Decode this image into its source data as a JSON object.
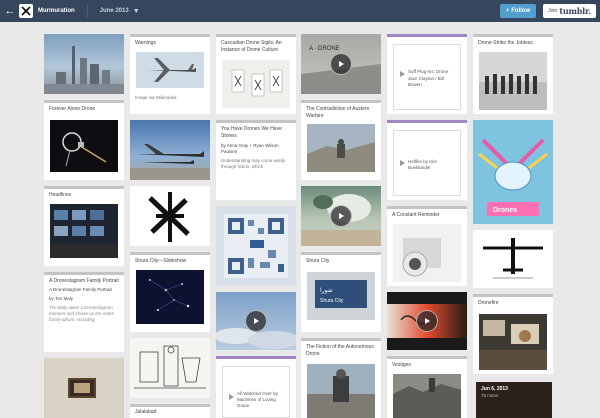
{
  "header": {
    "blog_name": "Murmuration",
    "archive_month": "June 2013",
    "follow_label": "Follow",
    "join_label": "Join",
    "brand": "tumblr."
  },
  "posts": {
    "warnings": {
      "title": "Warnings",
      "caption": "Image via Wikimedia"
    },
    "cascadian": {
      "title": "Cascadian Drone Sigils: An Instance of Drone Culture"
    },
    "suff": {
      "title": "Suff Plug-Ins: Drone",
      "author": "Jace Clayton / Bill Bowen"
    },
    "strike": {
      "title": "Drone-Strike the Jobless"
    },
    "forever": {
      "title": "Forever Alone Drone"
    },
    "contradiction": {
      "title": "The Contradiction of Austere Warfare"
    },
    "stones": {
      "title": "You Have Drones We Have Stones",
      "author": "by Anna Gray + Ryan Wilson Paulsen",
      "excerpt": "Understanding may come easily through fiction, which"
    },
    "hellfire": {
      "title": "Hellfire by Kim Boekbinder"
    },
    "headlines": {
      "title": "Headlines"
    },
    "reminder": {
      "title": "A Constant Reminder"
    },
    "slideshow": {
      "title": "Shura City—Slideshow"
    },
    "family": {
      "title": "A Dronestagram Family Portrait",
      "title2": "A Dronestagram Family Portrait",
      "by": "by Tim Maly",
      "excerpt": "Tim Maly takes a Dronestagram moment and shows us the entire family album, including"
    },
    "shura": {
      "title": "Shura City"
    },
    "dronefire": {
      "title": "Dronefire"
    },
    "fiction": {
      "title": "The Fiction of the Autonomous Drone"
    },
    "vestiges": {
      "title": "Vestiges"
    },
    "watched": {
      "title": "All Watched Over by Machines of Loving Grace"
    },
    "jalalabad": {
      "title": "Jalalabad"
    },
    "date_card": {
      "date": "Jun 6, 2013",
      "notes": "75 notes"
    }
  },
  "art": {
    "drone_sign": "A · DRONE",
    "poster_title": "Drones",
    "shura_sign": "Shura City"
  },
  "colors": {
    "topbar": "#36465d",
    "follow": "#529ecc",
    "purple_strip": "#a286c4",
    "gray_strip": "#c4c4c4"
  }
}
